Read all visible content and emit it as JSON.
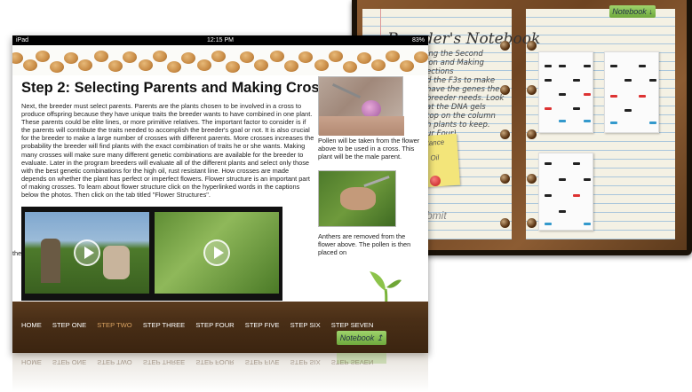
{
  "back_ipad": {
    "notebook_title": "Notebook",
    "partial_title": "Breeder's",
    "notebook_tab": "Notebook",
    "notes": [
      "ing the Second",
      "ion and Making",
      "ections",
      "",
      "d the F3s to make",
      "have the genes the",
      "breeder needs. Look",
      "at the DNA gels",
      "top on the column",
      "h plants to keep.",
      "ur Four)"
    ],
    "sticky_text": [
      "stance",
      "h Oil"
    ],
    "submit_text": "bmit"
  },
  "status_bar": {
    "carrier": "iPad",
    "time": "12:15 PM",
    "battery": "83%"
  },
  "page": {
    "title": "Step 2: Selecting Parents and Making Crosses",
    "body": "Next, the breeder must select parents. Parents are the plants chosen to be involved in a cross to produce offspring because they have unique traits the breeder wants to have combined in one plant. These parents could be elite lines, or more primitive relatives. The important factor to consider is if the parents will contribute the traits needed to accomplish the breeder's goal or not. It is also crucial for the breeder to make a large number of crosses with different parents. More crosses increases the probability the breeder will find plants with the exact combination of traits he or she wants. Making many crosses will make sure many different genetic combinations are available for the breeder to evaluate. Later in the program breeders will evaluate all of the different plants and select only those with the best genetic combinations for the high oil, rust resistant line. How crosses are made depends on whether the plant has perfect or imperfect flowers. Flower structure is an important part of making crosses. To learn about flower structure click on the hyperlinked words in the captions below the photos. Then click on the tab titled \"Flower Structures\".",
    "caption_1": "Pollen will be taken from the flower above to be used in a cross. This plant will be the male parent.",
    "caption_2": "Anthers are removed from the flower above. The pollen is then placed on",
    "partial_text": "the"
  },
  "nav": {
    "items": [
      "HOME",
      "STEP ONE",
      "STEP TWO",
      "STEP THREE",
      "STEP FOUR",
      "STEP FIVE",
      "STEP SIX",
      "STEP SEVEN"
    ],
    "active": "STEP TWO"
  },
  "notebook_tab": "Notebook"
}
